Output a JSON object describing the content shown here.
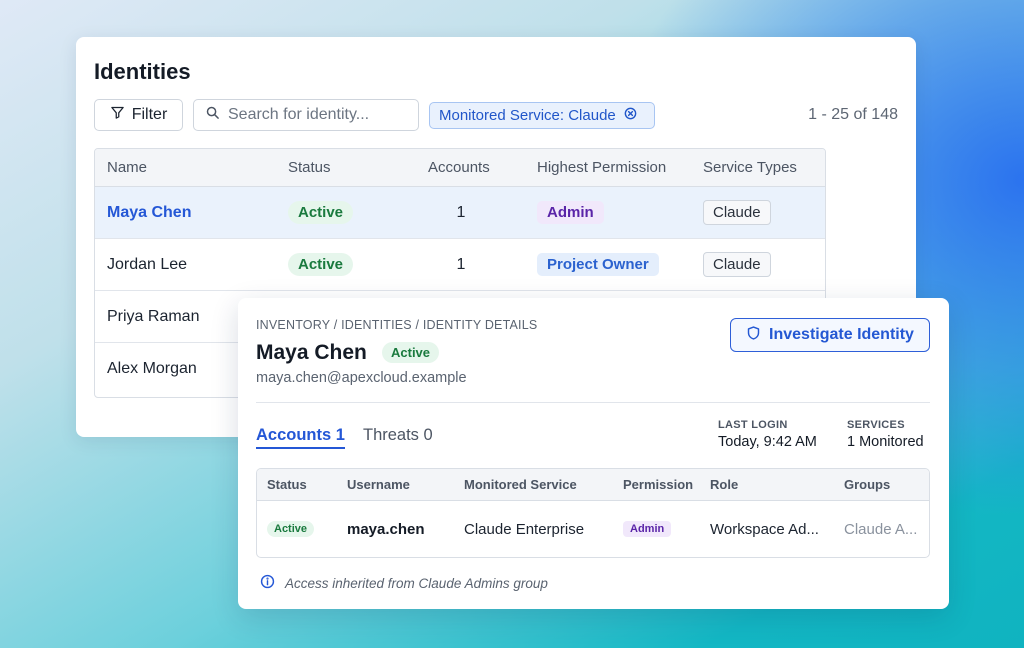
{
  "identities": {
    "title": "Identities",
    "filter_label": "Filter",
    "search_placeholder": "Search for identity...",
    "chip_label": "Monitored Service: Claude",
    "pagination": "1 - 25 of 148",
    "columns": [
      "Name",
      "Status",
      "Accounts",
      "Highest Permission",
      "Service Types"
    ],
    "rows": [
      {
        "name": "Maya Chen",
        "status": "Active",
        "accounts": "1",
        "permission": "Admin",
        "service": "Claude"
      },
      {
        "name": "Jordan Lee",
        "status": "Active",
        "accounts": "1",
        "permission": "Project Owner",
        "service": "Claude"
      },
      {
        "name": "Priya Raman"
      },
      {
        "name": "Alex Morgan"
      }
    ]
  },
  "detail": {
    "breadcrumb": "INVENTORY / IDENTITIES / IDENTITY DETAILS",
    "name": "Maya Chen",
    "status": "Active",
    "email": "maya.chen@apexcloud.example",
    "investigate_label": "Investigate Identity",
    "tabs": [
      {
        "label": "Accounts 1",
        "active": true
      },
      {
        "label": "Threats 0",
        "active": false
      }
    ],
    "last_login": {
      "label": "LAST LOGIN",
      "value": "Today, 9:42 AM"
    },
    "services": {
      "label": "SERVICES",
      "value": "1 Monitored"
    },
    "columns": [
      "Status",
      "Username",
      "Monitored Service",
      "Permission",
      "Role",
      "Groups"
    ],
    "account": {
      "status": "Active",
      "username": "maya.chen",
      "service": "Claude Enterprise",
      "permission": "Admin",
      "role": "Workspace Ad...",
      "groups": "Claude A..."
    },
    "note": "Access inherited from Claude Admins group"
  },
  "icons": {
    "filter": "filter-icon",
    "search": "search-icon",
    "chip_remove": "close-circle-icon",
    "investigate": "shield-icon",
    "info": "info-icon"
  },
  "colors": {
    "accent": "#2457d6",
    "active_green": "#1a7a3e",
    "admin_purple": "#5a24a8"
  }
}
